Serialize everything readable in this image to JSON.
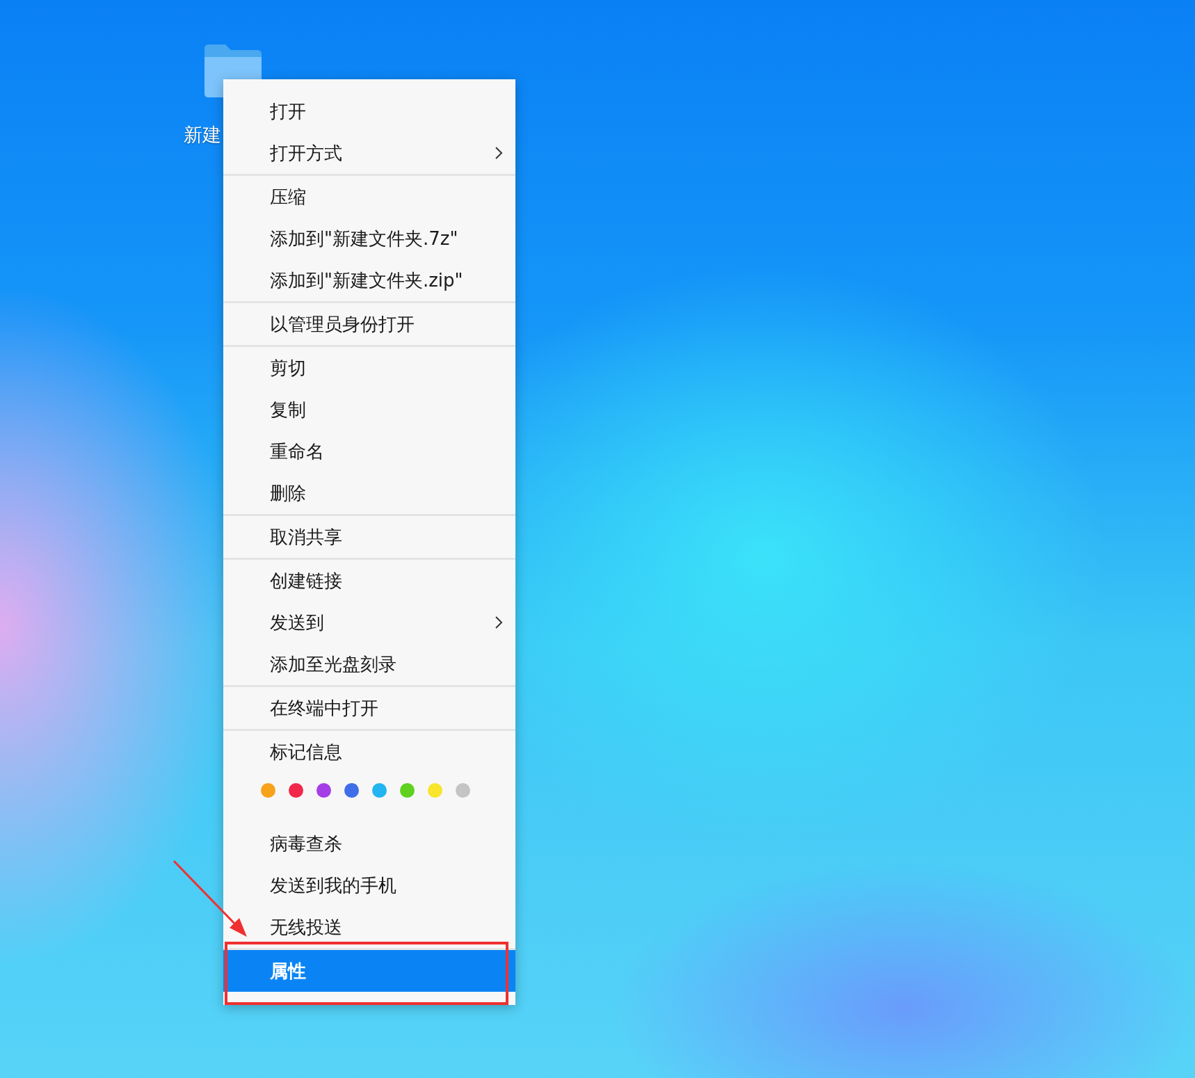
{
  "desktop": {
    "folder": {
      "label": "新建"
    }
  },
  "context_menu": {
    "groups": [
      {
        "items": [
          {
            "kind": "item",
            "label": "打开",
            "selected": false
          },
          {
            "kind": "submenu",
            "label": "打开方式",
            "selected": false
          }
        ]
      },
      {
        "items": [
          {
            "kind": "item",
            "label": "压缩",
            "selected": false
          },
          {
            "kind": "item",
            "label": "添加到\"新建文件夹.7z\"",
            "selected": false
          },
          {
            "kind": "item",
            "label": "添加到\"新建文件夹.zip\"",
            "selected": false
          }
        ]
      },
      {
        "items": [
          {
            "kind": "item",
            "label": "以管理员身份打开",
            "selected": false
          }
        ]
      },
      {
        "items": [
          {
            "kind": "item",
            "label": "剪切",
            "selected": false
          },
          {
            "kind": "item",
            "label": "复制",
            "selected": false
          },
          {
            "kind": "item",
            "label": "重命名",
            "selected": false
          },
          {
            "kind": "item",
            "label": "删除",
            "selected": false
          }
        ]
      },
      {
        "items": [
          {
            "kind": "item",
            "label": "取消共享",
            "selected": false
          }
        ]
      },
      {
        "items": [
          {
            "kind": "item",
            "label": "创建链接",
            "selected": false
          },
          {
            "kind": "submenu",
            "label": "发送到",
            "selected": false
          },
          {
            "kind": "item",
            "label": "添加至光盘刻录",
            "selected": false
          }
        ]
      },
      {
        "items": [
          {
            "kind": "item",
            "label": "在终端中打开",
            "selected": false
          }
        ]
      },
      {
        "items": [
          {
            "kind": "item",
            "label": "标记信息",
            "selected": false
          },
          {
            "kind": "colors",
            "colors": [
              {
                "color": "#f7a21b"
              },
              {
                "color": "#f0284a"
              },
              {
                "color": "#a43ee6"
              },
              {
                "color": "#3f6ee8"
              },
              {
                "color": "#22b5f0"
              },
              {
                "color": "#5fd11e"
              },
              {
                "color": "#f7e52e"
              },
              {
                "color": "#c4c4c4"
              }
            ]
          },
          {
            "kind": "item",
            "label": "病毒查杀",
            "selected": false
          },
          {
            "kind": "item",
            "label": "发送到我的手机",
            "selected": false
          },
          {
            "kind": "item",
            "label": "无线投送",
            "selected": false
          }
        ]
      },
      {
        "items": [
          {
            "kind": "item",
            "label": "属性",
            "selected": true
          }
        ]
      }
    ]
  }
}
